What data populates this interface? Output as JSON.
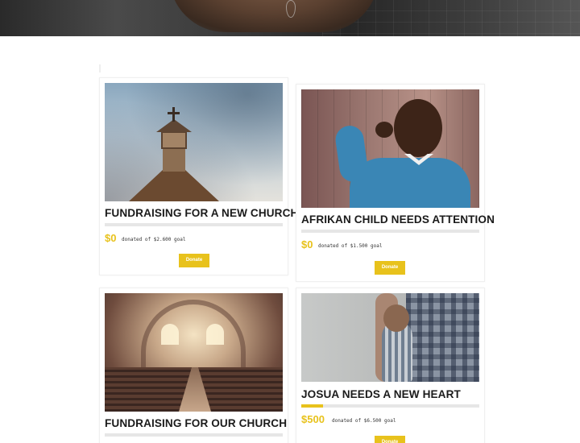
{
  "campaigns": [
    {
      "title": "FUNDRAISING FOR A NEW CHURCH",
      "raised": "$0",
      "goal_text": "donated of $2.600 goal",
      "progress": 0,
      "donate_label": "Donate",
      "image": "church-steeple-photo"
    },
    {
      "title": "AFRIKAN CHILD NEEDS ATTENTION",
      "raised": "$0",
      "goal_text": "donated of $1.500 goal",
      "progress": 0,
      "donate_label": "Donate",
      "image": "smiling-child-photo"
    },
    {
      "title": "FUNDRAISING FOR OUR CHURCH",
      "raised": "",
      "goal_text": "",
      "progress": 0,
      "donate_label": "",
      "image": "church-interior-photo"
    },
    {
      "title": "JOSUA NEEDS A NEW HEART",
      "raised": "$500",
      "goal_text": "donated of $6.500 goal",
      "progress": 0.12,
      "donate_label": "Donate",
      "image": "boy-hugging-father-photo"
    }
  ],
  "colors": {
    "accent": "#e8c21c",
    "title": "#1b1b1b",
    "bar_track": "#e6e6e6"
  }
}
